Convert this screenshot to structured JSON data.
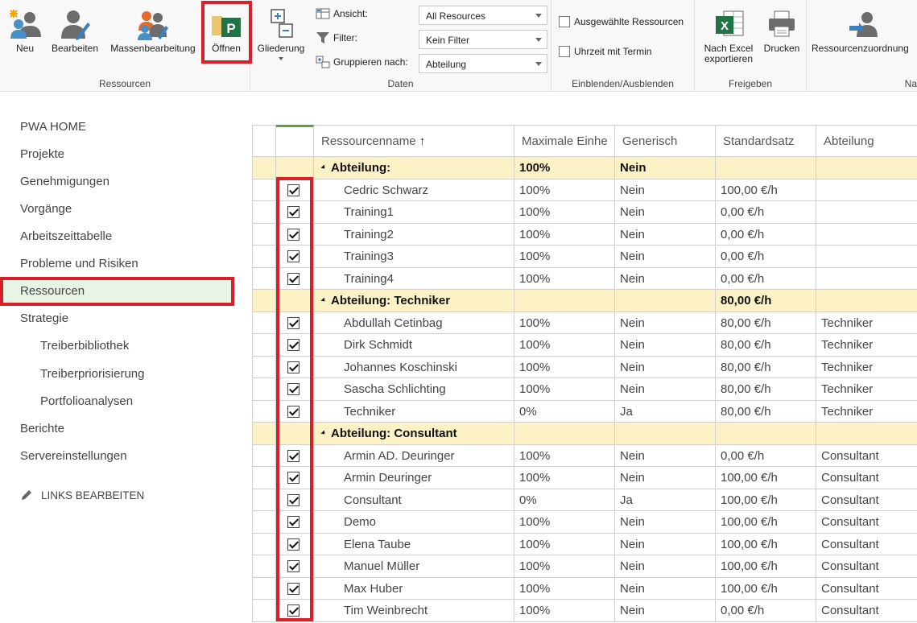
{
  "ribbon": {
    "groups": {
      "ressourcen": "Ressourcen",
      "daten": "Daten",
      "einblenden": "Einblenden/Ausblenden",
      "freigeben": "Freigeben",
      "na": "Na"
    },
    "buttons": {
      "neu": "Neu",
      "bearbeiten": "Bearbeiten",
      "massenbearbeitung": "Massenbearbeitung",
      "oeffnen": "Öffnen",
      "gliederung": "Gliederung",
      "excel_line1": "Nach Excel",
      "excel_line2": "exportieren",
      "drucken": "Drucken",
      "zuordnung": "Ressourcenzuordnung"
    },
    "daten": {
      "ansicht_label": "Ansicht:",
      "ansicht_value": "All Resources",
      "filter_label": "Filter:",
      "filter_value": "Kein Filter",
      "gruppieren_label": "Gruppieren nach:",
      "gruppieren_value": "Abteilung"
    },
    "einblenden": {
      "ausgewaehlte": "Ausgewählte Ressourcen",
      "uhrzeit": "Uhrzeit mit Termin"
    }
  },
  "nav": {
    "items": [
      "PWA HOME",
      "Projekte",
      "Genehmigungen",
      "Vorgänge",
      "Arbeitszeittabelle",
      "Probleme und Risiken",
      "Ressourcen",
      "Strategie"
    ],
    "subitems": [
      "Treiberbibliothek",
      "Treiberpriorisierung",
      "Portfolioanalysen"
    ],
    "bottom": [
      "Berichte",
      "Servereinstellungen"
    ],
    "links_edit": "LINKS BEARBEITEN"
  },
  "grid": {
    "columns": [
      "Ressourcenname",
      "Maximale Einhe",
      "Generisch",
      "Standardsatz",
      "Abteilung"
    ],
    "sort_glyph": "↑",
    "rows": [
      {
        "group": true,
        "name": "Abteilung:",
        "max": "100%",
        "gen": "Nein",
        "rate": "",
        "dept": ""
      },
      {
        "name": "Cedric Schwarz",
        "max": "100%",
        "gen": "Nein",
        "rate": "100,00 €/h",
        "dept": ""
      },
      {
        "name": "Training1",
        "max": "100%",
        "gen": "Nein",
        "rate": "0,00 €/h",
        "dept": ""
      },
      {
        "name": "Training2",
        "max": "100%",
        "gen": "Nein",
        "rate": "0,00 €/h",
        "dept": ""
      },
      {
        "name": "Training3",
        "max": "100%",
        "gen": "Nein",
        "rate": "0,00 €/h",
        "dept": ""
      },
      {
        "name": "Training4",
        "max": "100%",
        "gen": "Nein",
        "rate": "0,00 €/h",
        "dept": ""
      },
      {
        "group": true,
        "name": "Abteilung: Techniker",
        "max": "",
        "gen": "",
        "rate": "80,00 €/h",
        "dept": ""
      },
      {
        "name": "Abdullah Cetinbag",
        "max": "100%",
        "gen": "Nein",
        "rate": "80,00 €/h",
        "dept": "Techniker"
      },
      {
        "name": "Dirk Schmidt",
        "max": "100%",
        "gen": "Nein",
        "rate": "80,00 €/h",
        "dept": "Techniker"
      },
      {
        "name": "Johannes Koschinski",
        "max": "100%",
        "gen": "Nein",
        "rate": "80,00 €/h",
        "dept": "Techniker"
      },
      {
        "name": "Sascha Schlichting",
        "max": "100%",
        "gen": "Nein",
        "rate": "80,00 €/h",
        "dept": "Techniker"
      },
      {
        "name": "Techniker",
        "max": "0%",
        "gen": "Ja",
        "rate": "80,00 €/h",
        "dept": "Techniker"
      },
      {
        "group": true,
        "name": "Abteilung: Consultant",
        "max": "",
        "gen": "",
        "rate": "",
        "dept": ""
      },
      {
        "name": "Armin AD. Deuringer",
        "max": "100%",
        "gen": "Nein",
        "rate": "0,00 €/h",
        "dept": "Consultant"
      },
      {
        "name": "Armin Deuringer",
        "max": "100%",
        "gen": "Nein",
        "rate": "100,00 €/h",
        "dept": "Consultant"
      },
      {
        "name": "Consultant",
        "max": "0%",
        "gen": "Ja",
        "rate": "100,00 €/h",
        "dept": "Consultant"
      },
      {
        "name": "Demo",
        "max": "100%",
        "gen": "Nein",
        "rate": "100,00 €/h",
        "dept": "Consultant"
      },
      {
        "name": "Elena Taube",
        "max": "100%",
        "gen": "Nein",
        "rate": "100,00 €/h",
        "dept": "Consultant"
      },
      {
        "name": "Manuel Müller",
        "max": "100%",
        "gen": "Nein",
        "rate": "100,00 €/h",
        "dept": "Consultant"
      },
      {
        "name": "Max Huber",
        "max": "100%",
        "gen": "Nein",
        "rate": "100,00 €/h",
        "dept": "Consultant"
      },
      {
        "name": "Tim Weinbrecht",
        "max": "100%",
        "gen": "Nein",
        "rate": "0,00 €/h",
        "dept": "Consultant"
      }
    ]
  },
  "colors": {
    "highlight_red": "#d7202a",
    "group_row": "#fdf2c6",
    "nav_active": "#e8f5e4",
    "project_green": "#217346"
  }
}
